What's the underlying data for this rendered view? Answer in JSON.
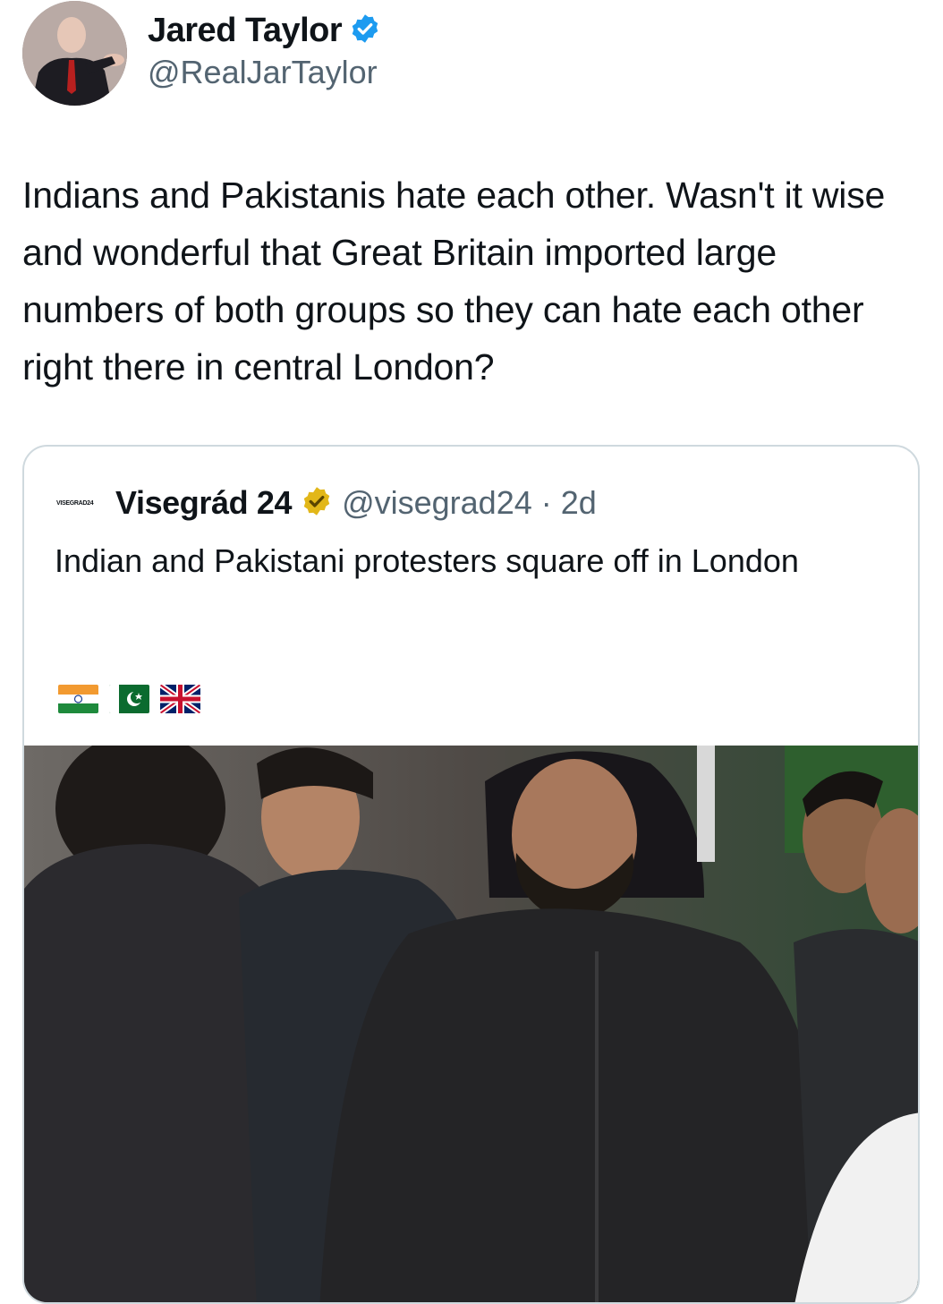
{
  "author": {
    "name": "Jared Taylor",
    "handle": "@RealJarTaylor",
    "verified_color": "#1d9bf0"
  },
  "tweet": {
    "text": "Indians and Pakistanis hate each other. Wasn't it wise and wonderful that Great Britain imported large numbers of both groups so they can hate each other right there in central London?"
  },
  "quote": {
    "logo_text": "VISEGRAD24",
    "name": "Visegrád 24",
    "handle": "@visegrad24",
    "separator": "·",
    "time": "2d",
    "badge_color": "#e2b719",
    "text": "Indian and Pakistani protesters square off in London",
    "flags": [
      "india-flag",
      "pakistan-flag",
      "uk-flag"
    ]
  }
}
